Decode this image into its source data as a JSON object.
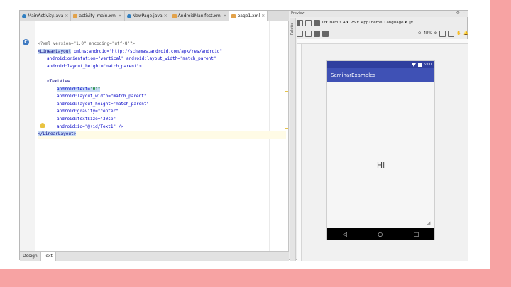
{
  "tabs": [
    {
      "label": "MainActivity.java",
      "icon": "class-icon"
    },
    {
      "label": "activity_main.xml",
      "icon": "xml-file-icon"
    },
    {
      "label": "NewPage.java",
      "icon": "class-icon"
    },
    {
      "label": "AndroidManifest.xml",
      "icon": "xml-file-icon"
    },
    {
      "label": "page1.xml",
      "icon": "xml-file-icon"
    }
  ],
  "active_tab_index": 4,
  "code": {
    "l1": "<?xml version=\"1.0\" encoding=\"utf-8\"?>",
    "l2_tag": "<LinearLayout",
    "l2_rest": " xmlns:android=\"http://schemas.android.com/apk/res/android\"",
    "l3": "android:orientation=\"vertical\" android:layout_width=\"match_parent\"",
    "l4": "android:layout_height=\"match_parent\">",
    "l6": "<TextView",
    "l7a": "android:text=",
    "l7b": "\"Hi\"",
    "l8": "android:layout_width=\"match_parent\"",
    "l9": "android:layout_height=\"match_parent\"",
    "l10": "android:gravity=\"center\"",
    "l11": "android:textSize=\"30sp\"",
    "l12": "android:id=\"@+id/Text1\" />",
    "l13": "</LinearLayout>"
  },
  "bottom_tabs": {
    "design": "Design",
    "text": "Text"
  },
  "preview": {
    "title": "Preview",
    "palette": "Palette",
    "device": "Nexus 4 ▾",
    "api": "25 ▾",
    "theme": "AppTheme",
    "language": "Language ▾",
    "zoom": "48%",
    "app_title": "SeminarExamples",
    "time": "6:00",
    "content_text": "Hi",
    "nav_back": "◁",
    "nav_home": "○",
    "nav_recent": "□"
  },
  "colors": {
    "accent_pink": "#f7a3a3",
    "appbar": "#3f51b5",
    "statusbar": "#303f9f"
  }
}
